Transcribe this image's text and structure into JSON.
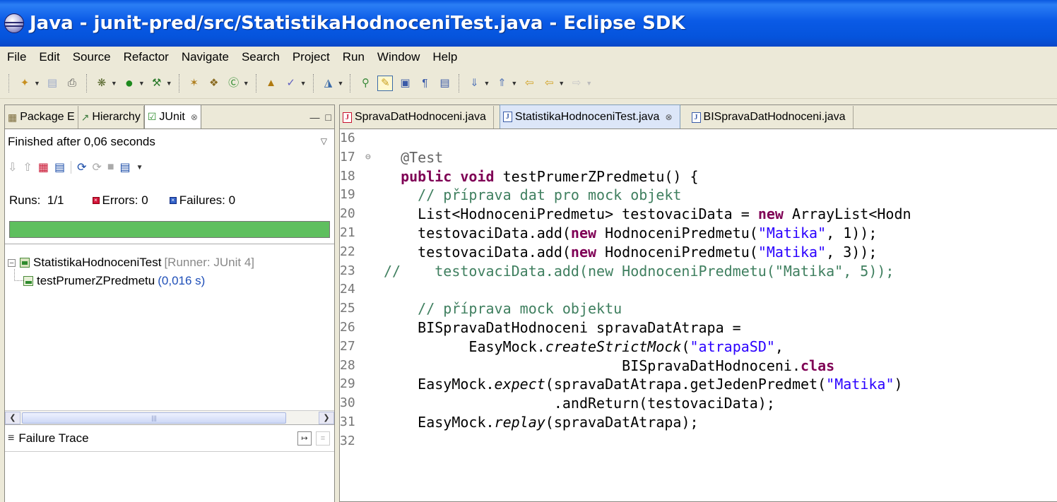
{
  "window": {
    "title": "Java - junit-pred/src/StatistikaHodnoceniTest.java - Eclipse SDK"
  },
  "menu": [
    "File",
    "Edit",
    "Source",
    "Refactor",
    "Navigate",
    "Search",
    "Project",
    "Run",
    "Window",
    "Help"
  ],
  "left_panel": {
    "tabs": [
      {
        "label": "Package E",
        "icon": "package-explorer-icon"
      },
      {
        "label": "Hierarchy",
        "icon": "hierarchy-icon"
      },
      {
        "label": "JUnit",
        "icon": "junit-icon",
        "close": "⊗"
      }
    ],
    "status": "Finished after 0,06 seconds",
    "runs_label": "Runs:",
    "runs_value": "1/1",
    "errors_label": "Errors:",
    "errors_value": "0",
    "failures_label": "Failures:",
    "failures_value": "0",
    "progress_fraction": 1.0,
    "progress_color": "#5fbf5f",
    "tree": {
      "suite_name": "StatistikaHodnoceniTest",
      "suite_meta": "[Runner: JUnit 4]",
      "test_name": "testPrumerZPredmetu",
      "test_time": "(0,016 s)"
    },
    "failure_trace_label": "Failure Trace"
  },
  "editor": {
    "tabs": [
      {
        "label": "SpravaDatHodnoceni.java",
        "active": false,
        "error": true
      },
      {
        "label": "StatistikaHodnoceniTest.java",
        "active": true,
        "close": "⊗"
      },
      {
        "label": "BISpravaDatHodnoceni.java",
        "active": false
      }
    ],
    "lines": [
      {
        "n": "16",
        "fold": "",
        "tokens": []
      },
      {
        "n": "17",
        "fold": "⊖",
        "tokens": [
          {
            "t": "  ",
            "c": ""
          },
          {
            "t": "@Test",
            "c": "ann"
          }
        ]
      },
      {
        "n": "18",
        "fold": "",
        "tokens": [
          {
            "t": "  ",
            "c": ""
          },
          {
            "t": "public",
            "c": "kw"
          },
          {
            "t": " ",
            "c": ""
          },
          {
            "t": "void",
            "c": "kw"
          },
          {
            "t": " testPrumerZPredmetu() {",
            "c": ""
          }
        ]
      },
      {
        "n": "19",
        "fold": "",
        "tokens": [
          {
            "t": "    ",
            "c": ""
          },
          {
            "t": "// příprava dat pro mock objekt",
            "c": "cmt"
          }
        ]
      },
      {
        "n": "20",
        "fold": "",
        "tokens": [
          {
            "t": "    List<HodnoceniPredmetu> testovaciData = ",
            "c": ""
          },
          {
            "t": "new",
            "c": "kw"
          },
          {
            "t": " ArrayList<Hodn",
            "c": ""
          }
        ]
      },
      {
        "n": "21",
        "fold": "",
        "tokens": [
          {
            "t": "    testovaciData.add(",
            "c": ""
          },
          {
            "t": "new",
            "c": "kw"
          },
          {
            "t": " HodnoceniPredmetu(",
            "c": ""
          },
          {
            "t": "\"Matika\"",
            "c": "str"
          },
          {
            "t": ", 1));",
            "c": ""
          }
        ]
      },
      {
        "n": "22",
        "fold": "",
        "tokens": [
          {
            "t": "    testovaciData.add(",
            "c": ""
          },
          {
            "t": "new",
            "c": "kw"
          },
          {
            "t": " HodnoceniPredmetu(",
            "c": ""
          },
          {
            "t": "\"Matika\"",
            "c": "str"
          },
          {
            "t": ", 3));",
            "c": ""
          }
        ]
      },
      {
        "n": "23",
        "fold": "",
        "tokens": [
          {
            "t": "//    testovaciData.add(new HodnoceniPredmetu(\"Matika\", 5));",
            "c": "cmt"
          }
        ]
      },
      {
        "n": "24",
        "fold": "",
        "tokens": []
      },
      {
        "n": "25",
        "fold": "",
        "tokens": [
          {
            "t": "    ",
            "c": ""
          },
          {
            "t": "// příprava mock objektu",
            "c": "cmt"
          }
        ]
      },
      {
        "n": "26",
        "fold": "",
        "tokens": [
          {
            "t": "    BISpravaDatHodnoceni spravaDatAtrapa =",
            "c": ""
          }
        ]
      },
      {
        "n": "27",
        "fold": "",
        "tokens": [
          {
            "t": "          EasyMock.",
            "c": ""
          },
          {
            "t": "createStrictMock",
            "c": "it"
          },
          {
            "t": "(",
            "c": ""
          },
          {
            "t": "\"atrapaSD\"",
            "c": "str"
          },
          {
            "t": ",",
            "c": ""
          }
        ]
      },
      {
        "n": "28",
        "fold": "",
        "tokens": [
          {
            "t": "                            BISpravaDatHodnoceni.",
            "c": ""
          },
          {
            "t": "clas",
            "c": "kw"
          }
        ]
      },
      {
        "n": "29",
        "fold": "",
        "tokens": [
          {
            "t": "    EasyMock.",
            "c": ""
          },
          {
            "t": "expect",
            "c": "it"
          },
          {
            "t": "(spravaDatAtrapa.getJedenPredmet(",
            "c": ""
          },
          {
            "t": "\"Matika\"",
            "c": "str"
          },
          {
            "t": ")",
            "c": ""
          }
        ]
      },
      {
        "n": "30",
        "fold": "",
        "tokens": [
          {
            "t": "                    .andReturn(testovaciData);",
            "c": ""
          }
        ]
      },
      {
        "n": "31",
        "fold": "",
        "tokens": [
          {
            "t": "    EasyMock.",
            "c": ""
          },
          {
            "t": "replay",
            "c": "it"
          },
          {
            "t": "(spravaDatAtrapa);",
            "c": ""
          }
        ]
      },
      {
        "n": "32",
        "fold": "",
        "tokens": []
      }
    ]
  }
}
